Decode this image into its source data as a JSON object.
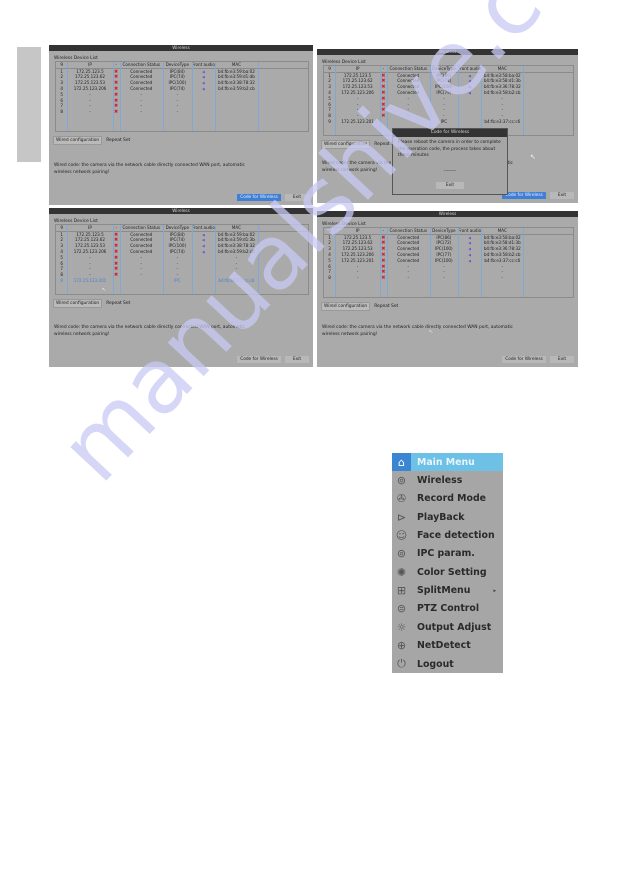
{
  "watermark": "manualshive.com",
  "panels": [
    {
      "title": "Wireless",
      "list_title": "Wireless Device List",
      "headers": [
        "9",
        "IP",
        "-",
        "Connection Status",
        "DeviceType",
        "Front audio",
        "MAC"
      ],
      "rows": [
        {
          "n": "1",
          "ip": "172.25.123.5",
          "status": "Connected",
          "type": "IPC(84)",
          "mac": "b4:fb:e3:59:ba:02",
          "audio": true
        },
        {
          "n": "2",
          "ip": "172.25.123.62",
          "status": "Connected",
          "type": "IPC(74)",
          "mac": "b4:fb:e3:59:d1:db",
          "audio": true
        },
        {
          "n": "3",
          "ip": "172.25.123.53",
          "status": "Connected",
          "type": "IPC(100)",
          "mac": "b4:fb:e3:38:78:32",
          "audio": true
        },
        {
          "n": "4",
          "ip": "172.25.123.206",
          "status": "Connected",
          "type": "IPC(74)",
          "mac": "b4:fb:e3:59:b2:cb",
          "audio": true
        },
        {
          "n": "5",
          "ip": "-",
          "status": "-",
          "type": "-",
          "mac": "",
          "audio": false
        },
        {
          "n": "6",
          "ip": "-",
          "status": "-",
          "type": "-",
          "mac": "",
          "audio": false
        },
        {
          "n": "7",
          "ip": "-",
          "status": "-",
          "type": "-",
          "mac": "",
          "audio": false
        },
        {
          "n": "8",
          "ip": "-",
          "status": "-",
          "type": "-",
          "mac": "",
          "audio": false
        }
      ],
      "tabs": [
        "Wired configuration",
        "Repeat Set"
      ],
      "description": "Wired code: the camera via the network cable directly connected WAN port, automatic wireless network pairing!",
      "buttons": {
        "code": "Code for Wireless",
        "exit": "Exit"
      },
      "code_highlighted": true
    },
    {
      "title": "Wireless",
      "list_title": "Wireless Device List",
      "headers": [
        "9",
        "IP",
        "-",
        "Connection Status",
        "DeviceType",
        "Front audio",
        "MAC"
      ],
      "rows": [
        {
          "n": "1",
          "ip": "172.25.123.5",
          "status": "Connected",
          "type": "IPC(86)",
          "mac": "b4:fb:e3:58:ba:02",
          "audio": true
        },
        {
          "n": "2",
          "ip": "172.25.123.62",
          "status": "Connected",
          "type": "IPC(74)",
          "mac": "b4:fb:e3:58:d1:3b",
          "audio": true
        },
        {
          "n": "3",
          "ip": "172.25.123.53",
          "status": "Connected",
          "type": "IPC(100)",
          "mac": "b4:fb:e3:36:78:32",
          "audio": true
        },
        {
          "n": "4",
          "ip": "172.25.123.206",
          "status": "Connected",
          "type": "IPC(79)",
          "mac": "b4:fb:e3:58:b2:cb",
          "audio": true
        },
        {
          "n": "5",
          "ip": "-",
          "status": "-",
          "type": "-",
          "mac": "-",
          "audio": false
        },
        {
          "n": "6",
          "ip": "-",
          "status": "-",
          "type": "-",
          "mac": "-",
          "audio": false
        },
        {
          "n": "7",
          "ip": "-",
          "status": "-",
          "type": "-",
          "mac": "-",
          "audio": false
        },
        {
          "n": "8",
          "ip": "-",
          "status": "-",
          "type": "-",
          "mac": "-",
          "audio": false
        },
        {
          "n": "9",
          "ip": "172.25.123.201",
          "status": "",
          "type": "IPC",
          "mac": "b4:fb:e3:37:cc:c6",
          "audio": false,
          "noX": true
        }
      ],
      "tabs": [
        "Wired configuration",
        "Repeat Set"
      ],
      "description": "Wired code: the camera via the network cable directly connected WAN port, automatic wireless network pairing!",
      "buttons": {
        "code": "Code for Wireless",
        "exit": "Exit"
      },
      "code_highlighted": true,
      "dialog": {
        "title": "Code for Wireless",
        "message": "Please reboot the camera in order to complete the operation code, the process takes about three minutes",
        "progress": "--------",
        "exit": "Exit"
      }
    },
    {
      "title": "Wireless",
      "list_title": "Wireless Device List",
      "headers": [
        "9",
        "IP",
        "-",
        "Connection Status",
        "DeviceType",
        "Front audio",
        "MAC"
      ],
      "rows": [
        {
          "n": "1",
          "ip": "172.25.123.5",
          "status": "Connected",
          "type": "IPC(84)",
          "mac": "b4:fb:e3:59:ba:02",
          "audio": true
        },
        {
          "n": "2",
          "ip": "172.25.123.62",
          "status": "Connected",
          "type": "IPC(74)",
          "mac": "b4:fb:e3:59:d1:3b",
          "audio": true
        },
        {
          "n": "3",
          "ip": "172.25.123.53",
          "status": "Connected",
          "type": "IPC(100)",
          "mac": "b4:fb:e3:38:78:32",
          "audio": true
        },
        {
          "n": "4",
          "ip": "172.25.123.206",
          "status": "Connected",
          "type": "IPC(74)",
          "mac": "b4:fb:e3:59:b2:cb",
          "audio": true
        },
        {
          "n": "5",
          "ip": "-",
          "status": "-",
          "type": "-",
          "mac": "-",
          "audio": false
        },
        {
          "n": "6",
          "ip": "-",
          "status": "-",
          "type": "-",
          "mac": "-",
          "audio": false
        },
        {
          "n": "7",
          "ip": "-",
          "status": "-",
          "type": "-",
          "mac": "-",
          "audio": false
        },
        {
          "n": "8",
          "ip": "-",
          "status": "-",
          "type": "-",
          "mac": "-",
          "audio": false
        },
        {
          "n": "9",
          "ip": "172.25.123.201",
          "status": "",
          "type": "IPC",
          "mac": "b4:fb:e3:37:cc:c6",
          "audio": false,
          "noX": true,
          "selected": true
        }
      ],
      "tabs": [
        "Wired configuration",
        "Repeat Set"
      ],
      "description": "Wired code: the camera via the network cable directly connected WAN port, automatic wireless network pairing!",
      "buttons": {
        "code": "Code for Wireless",
        "exit": "Exit"
      },
      "code_highlighted": false
    },
    {
      "title": "Wireless",
      "list_title": "Wireless Device List",
      "headers": [
        "8",
        "IP",
        "-",
        "Connection Status",
        "DeviceType",
        "Front audio",
        "MAC"
      ],
      "rows": [
        {
          "n": "1",
          "ip": "172.25.123.5",
          "status": "Connected",
          "type": "IPC(86)",
          "mac": "b4:fb:e3:58:ba:02",
          "audio": true
        },
        {
          "n": "2",
          "ip": "172.25.123.62",
          "status": "Connected",
          "type": "IPC(72)",
          "mac": "b4:fb:e3:58:d1:3b",
          "audio": true
        },
        {
          "n": "3",
          "ip": "172.25.123.53",
          "status": "Connected",
          "type": "IPC(100)",
          "mac": "b4:fb:e3:36:78:32",
          "audio": true
        },
        {
          "n": "4",
          "ip": "172.25.123.206",
          "status": "Connected",
          "type": "IPC(77)",
          "mac": "b4:fb:e3:58:b2:cb",
          "audio": true
        },
        {
          "n": "5",
          "ip": "172.25.123.201",
          "status": "Connected",
          "type": "IPC(100)",
          "mac": "b4:fb:e3:37:cc:c6",
          "audio": true
        },
        {
          "n": "6",
          "ip": "-",
          "status": "-",
          "type": "-",
          "mac": "-",
          "audio": false
        },
        {
          "n": "7",
          "ip": "-",
          "status": "-",
          "type": "-",
          "mac": "-",
          "audio": false
        },
        {
          "n": "8",
          "ip": "-",
          "status": "-",
          "type": "-",
          "mac": "-",
          "audio": false
        }
      ],
      "tabs": [
        "Wired configuration",
        "Repeat Set"
      ],
      "description": "Wired code: the camera via the network cable directly connected WAN port, automatic wireless network pairing!",
      "buttons": {
        "code": "Code for Wireless",
        "exit": "Exit"
      },
      "code_highlighted": false
    }
  ],
  "menu": {
    "items": [
      {
        "label": "Main Menu",
        "icon": "home-icon",
        "glyph": "⌂",
        "header": true
      },
      {
        "label": "Wireless",
        "icon": "wireless-camera-icon",
        "glyph": "⊚"
      },
      {
        "label": "Record Mode",
        "icon": "record-reel-icon",
        "glyph": "✇"
      },
      {
        "label": "PlayBack",
        "icon": "play-circle-icon",
        "glyph": "⊳"
      },
      {
        "label": "Face detection",
        "icon": "face-detection-icon",
        "glyph": "☺"
      },
      {
        "label": "IPC param.",
        "icon": "ipc-camera-icon",
        "glyph": "⊚"
      },
      {
        "label": "Color Setting",
        "icon": "palette-icon",
        "glyph": "✺"
      },
      {
        "label": "SplitMenu",
        "icon": "grid-split-icon",
        "glyph": "⊞",
        "submenu": true
      },
      {
        "label": "PTZ Control",
        "icon": "ptz-camera-icon",
        "glyph": "⊜"
      },
      {
        "label": "Output Adjust",
        "icon": "brightness-icon",
        "glyph": "☼"
      },
      {
        "label": "NetDetect",
        "icon": "globe-icon",
        "glyph": "⊕"
      },
      {
        "label": "Logout",
        "icon": "power-icon",
        "glyph": "⏻"
      }
    ],
    "submenu_arrow": "▸"
  },
  "cursor": "↖"
}
